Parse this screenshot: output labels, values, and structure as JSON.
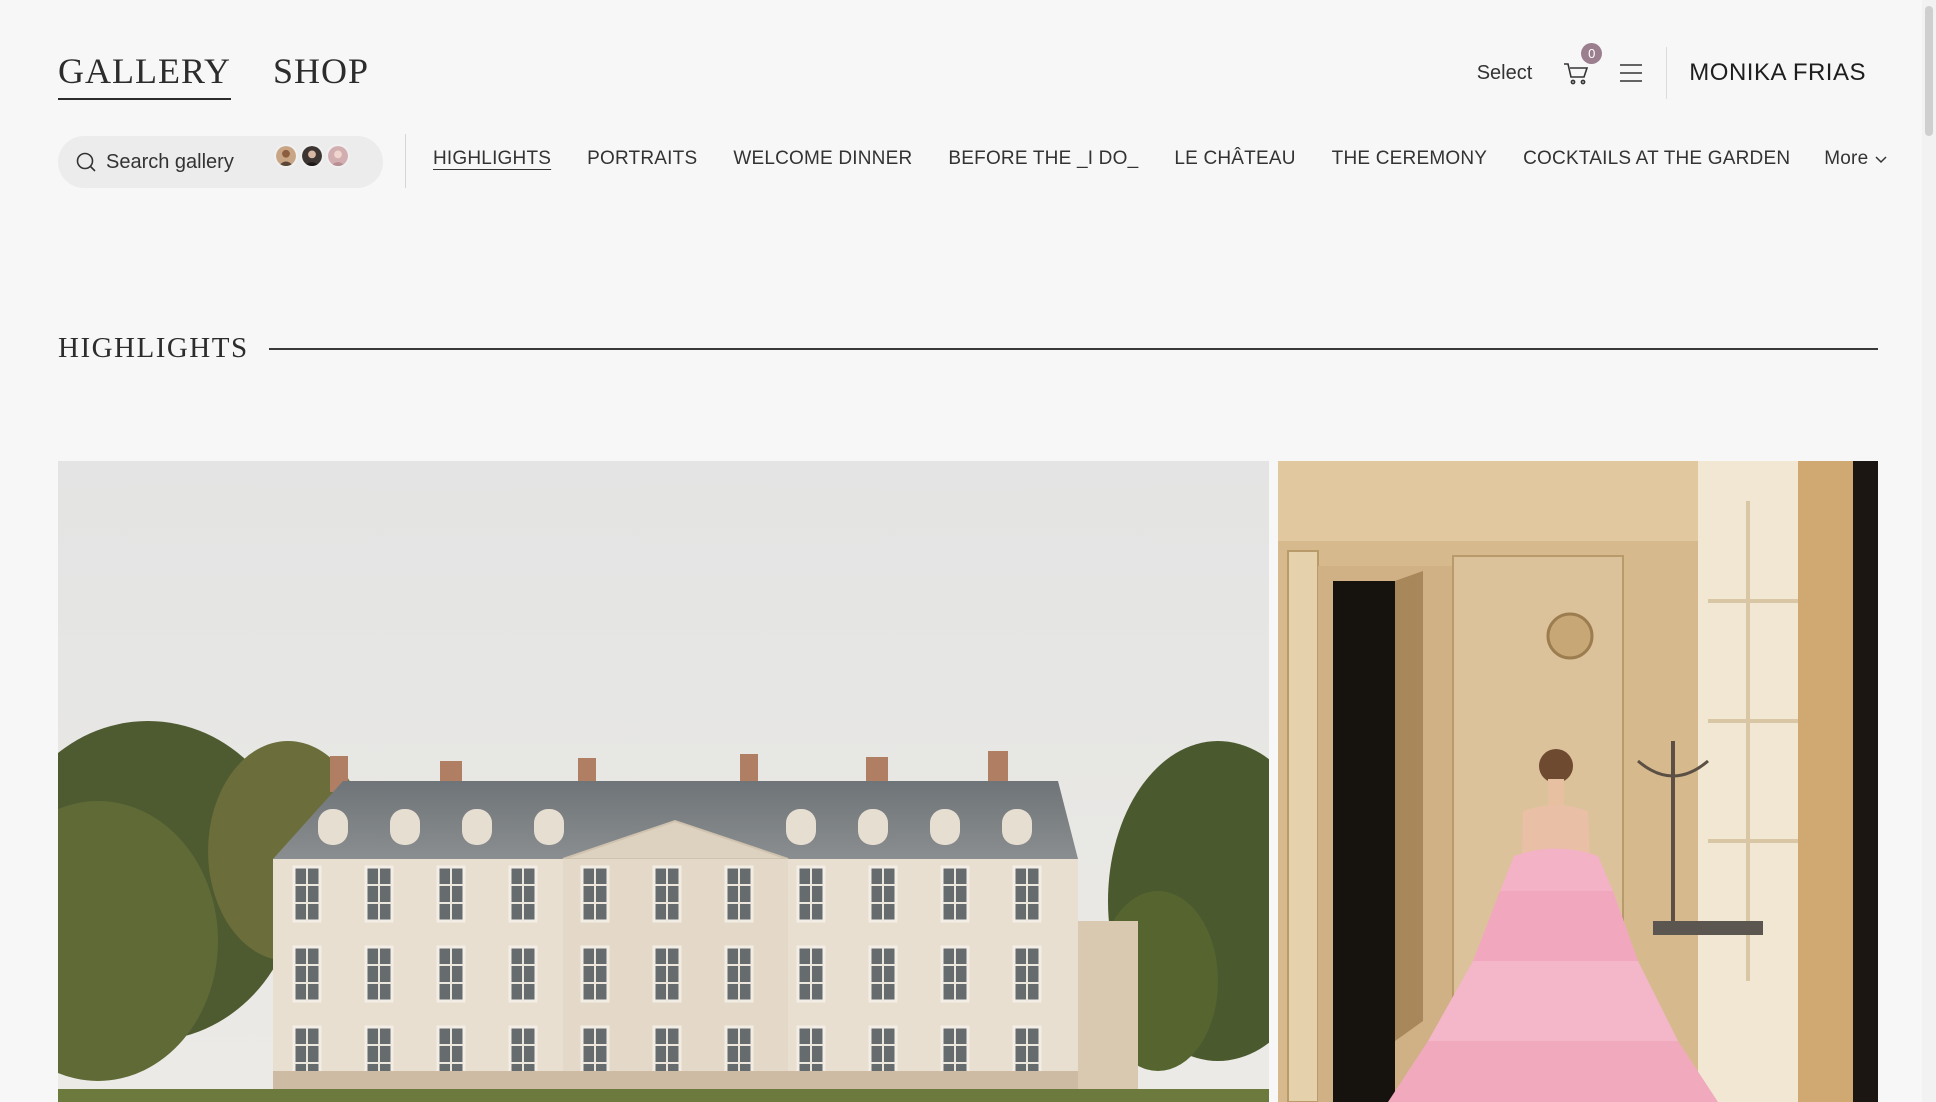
{
  "header": {
    "tabs": [
      {
        "label": "GALLERY",
        "active": true
      },
      {
        "label": "SHOP",
        "active": false
      }
    ],
    "select_label": "Select",
    "cart_count": "0",
    "brand": "MONIKA FRIAS"
  },
  "search": {
    "placeholder": "Search gallery"
  },
  "sections": [
    {
      "label": "HIGHLIGHTS",
      "active": true
    },
    {
      "label": "PORTRAITS"
    },
    {
      "label": "WELCOME DINNER"
    },
    {
      "label": "BEFORE THE _I DO_"
    },
    {
      "label": "LE CHÂTEAU"
    },
    {
      "label": "THE CEREMONY"
    },
    {
      "label": "COCKTAILS AT THE GARDEN"
    }
  ],
  "more_label": "More",
  "heading": "HIGHLIGHTS",
  "photos": [
    {
      "subject": "chateau-exterior"
    },
    {
      "subject": "bride-pink-gown"
    }
  ],
  "colors": {
    "background": "#f7f7f7",
    "text": "#2b2b2b",
    "cart_badge": "#9c7f8f",
    "search_bg": "#ececec"
  }
}
